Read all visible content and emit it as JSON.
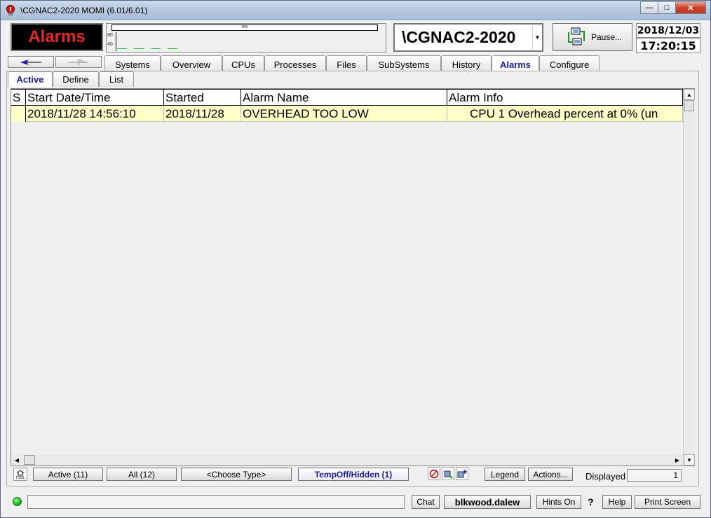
{
  "window": {
    "title": "\\CGNAC2-2020 MOMI (6.01/6.01)",
    "min_glyph": "—",
    "max_glyph": "□",
    "close_glyph": "✕"
  },
  "header": {
    "badge": "Alarms",
    "percent_label": "0%",
    "graph_axis": [
      "80",
      "40"
    ],
    "system": "\\CGNAC2-2020",
    "pause_label": "Pause...",
    "date": "2018/12/03",
    "time": "17:20:15"
  },
  "main_tabs": [
    "Systems",
    "Overview",
    "CPUs",
    "Processes",
    "Files",
    "SubSystems",
    "History",
    "Alarms",
    "Configure"
  ],
  "main_tab_active": "Alarms",
  "sub_tabs": [
    "Active",
    "Define",
    "List"
  ],
  "sub_tab_active": "Active",
  "table": {
    "columns": [
      "S",
      "Start Date/Time",
      "Started",
      "Alarm Name",
      "Alarm Info"
    ],
    "rows": [
      {
        "s": "",
        "start": "2018/11/28 14:56:10",
        "started": "2018/11/28",
        "name": "OVERHEAD TOO LOW",
        "info": "CPU 1 Overhead percent at 0% (un"
      }
    ]
  },
  "toolbar": {
    "tool_label": "TOOL",
    "active_btn": "Active (11)",
    "all_btn": "All (12)",
    "type_btn": "<Choose Type>",
    "temp_btn": "TempOff/Hidden (1)",
    "legend_btn": "Legend",
    "actions_btn": "Actions...",
    "displayed_label": "Displayed",
    "displayed_value": "1"
  },
  "statusbar": {
    "chat": "Chat",
    "user": "blkwood.dalew",
    "hints": "Hints On",
    "question": "?",
    "help": "Help",
    "print": "Print Screen"
  },
  "colors": {
    "alarm_red": "#e8252b",
    "active_tab_blue": "#1a1aa8",
    "alarm_row_yellow": "#ffffc8",
    "status_green": "#15b415"
  }
}
